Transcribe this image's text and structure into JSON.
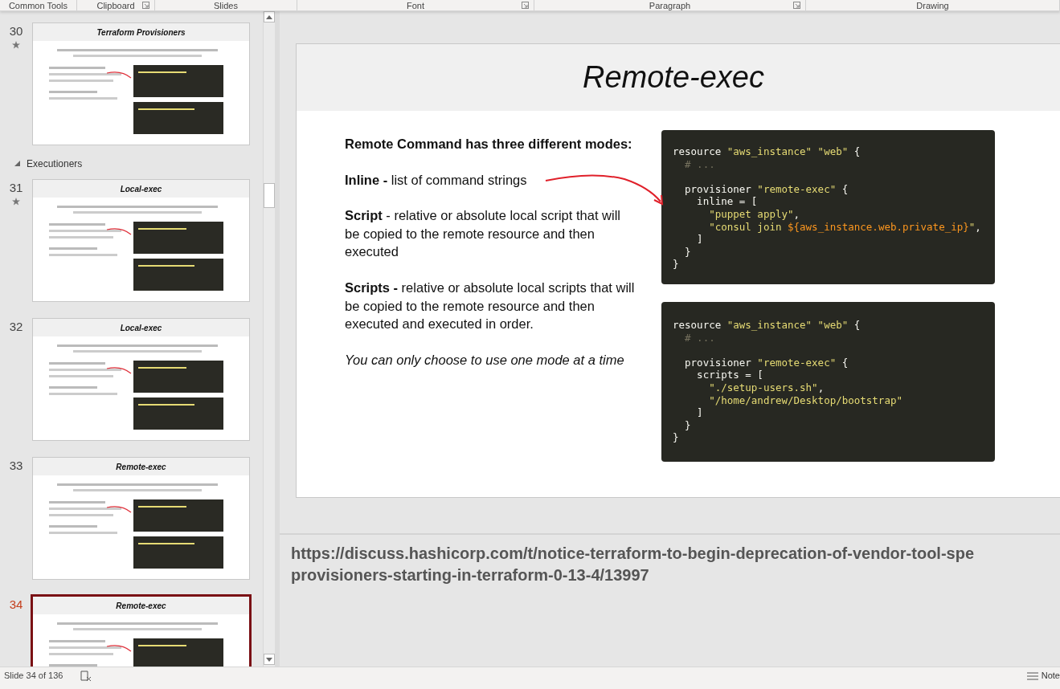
{
  "ribbon_groups": [
    {
      "label": "Common Tools",
      "launcher": false
    },
    {
      "label": "Clipboard",
      "launcher": true
    },
    {
      "label": "Slides",
      "launcher": false
    },
    {
      "label": "Font",
      "launcher": true
    },
    {
      "label": "Paragraph",
      "launcher": true
    },
    {
      "label": "Drawing",
      "launcher": false
    }
  ],
  "thumbnails": [
    {
      "kind": "slide",
      "number": "30",
      "starred": true,
      "selected": false,
      "title": "Terraform Provisioners"
    },
    {
      "kind": "section",
      "label": "Executioners",
      "expanded": true
    },
    {
      "kind": "slide",
      "number": "31",
      "starred": true,
      "selected": false,
      "title": "Local-exec"
    },
    {
      "kind": "slide",
      "number": "32",
      "starred": false,
      "selected": false,
      "title": "Local-exec"
    },
    {
      "kind": "slide",
      "number": "33",
      "starred": false,
      "selected": false,
      "title": "Remote-exec"
    },
    {
      "kind": "slide",
      "number": "34",
      "starred": false,
      "selected": true,
      "title": "Remote-exec"
    }
  ],
  "slide": {
    "title": "Remote-exec",
    "paragraphs": [
      {
        "kind": "heading",
        "text": "Remote Command has three different modes:"
      },
      {
        "kind": "body",
        "text": "**Inline -**  list of command strings"
      },
      {
        "kind": "body",
        "text": "**Script** - relative or absolute local script that will be copied to the remote resource and then executed"
      },
      {
        "kind": "body",
        "text": "**Scripts -** relative or absolute local scripts that will be copied to the remote resource and then executed and executed in order."
      },
      {
        "kind": "note",
        "text": "You can only choose to use one mode at a time"
      }
    ],
    "code_blocks": [
      {
        "lines": [
          {
            "tokens": [
              {
                "kind": "plain",
                "text": "resource "
              },
              {
                "kind": "string",
                "text": "\"aws_instance\" \"web\""
              },
              {
                "kind": "plain",
                "text": " {"
              }
            ]
          },
          {
            "tokens": [
              {
                "kind": "comment",
                "text": "  # ..."
              }
            ]
          },
          {
            "gap_before": true,
            "tokens": [
              {
                "kind": "plain",
                "text": "  provisioner "
              },
              {
                "kind": "string",
                "text": "\"remote-exec\""
              },
              {
                "kind": "plain",
                "text": " {"
              }
            ]
          },
          {
            "tokens": [
              {
                "kind": "plain",
                "text": "    inline = ["
              }
            ]
          },
          {
            "tokens": [
              {
                "kind": "string",
                "text": "      \"puppet apply\""
              },
              {
                "kind": "plain",
                "text": ","
              }
            ]
          },
          {
            "tokens": [
              {
                "kind": "string",
                "text": "      \"consul join "
              },
              {
                "kind": "interp",
                "text": "${aws_instance.web.private_ip}"
              },
              {
                "kind": "string",
                "text": "\""
              },
              {
                "kind": "plain",
                "text": ","
              }
            ]
          },
          {
            "tokens": [
              {
                "kind": "plain",
                "text": "    ]"
              }
            ]
          },
          {
            "tokens": [
              {
                "kind": "plain",
                "text": "  }"
              }
            ]
          },
          {
            "tokens": [
              {
                "kind": "plain",
                "text": "}"
              }
            ]
          }
        ]
      },
      {
        "lines": [
          {
            "tokens": [
              {
                "kind": "plain",
                "text": "resource "
              },
              {
                "kind": "string",
                "text": "\"aws_instance\" \"web\""
              },
              {
                "kind": "plain",
                "text": " {"
              }
            ]
          },
          {
            "tokens": [
              {
                "kind": "comment",
                "text": "  # ..."
              }
            ]
          },
          {
            "gap_before": true,
            "tokens": [
              {
                "kind": "plain",
                "text": "  provisioner "
              },
              {
                "kind": "string",
                "text": "\"remote-exec\""
              },
              {
                "kind": "plain",
                "text": " {"
              }
            ]
          },
          {
            "tokens": [
              {
                "kind": "plain",
                "text": "    scripts = ["
              }
            ]
          },
          {
            "tokens": [
              {
                "kind": "string",
                "text": "      \"./setup-users.sh\""
              },
              {
                "kind": "plain",
                "text": ","
              }
            ]
          },
          {
            "tokens": [
              {
                "kind": "string",
                "text": "      \"/home/andrew/Desktop/bootstrap\""
              }
            ]
          },
          {
            "tokens": [
              {
                "kind": "plain",
                "text": "    ]"
              }
            ]
          },
          {
            "tokens": [
              {
                "kind": "plain",
                "text": "  }"
              }
            ]
          },
          {
            "tokens": [
              {
                "kind": "plain",
                "text": "}"
              }
            ]
          }
        ]
      }
    ]
  },
  "notes": {
    "lines": [
      "https://discuss.hashicorp.com/t/notice-terraform-to-begin-deprecation-of-vendor-tool-spe",
      "provisioners-starting-in-terraform-0-13-4/13997"
    ]
  },
  "status_bar": {
    "slide_indicator": "Slide 34 of 136",
    "notes_button": "Note"
  }
}
